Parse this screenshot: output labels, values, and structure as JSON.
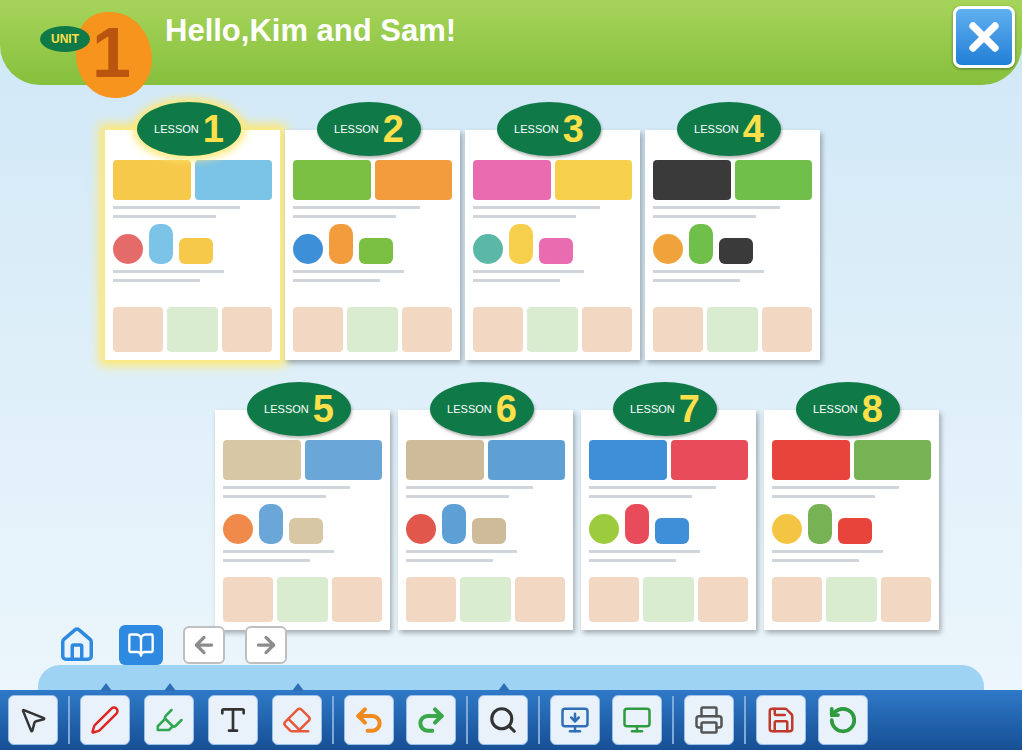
{
  "unit": {
    "label": "UNIT",
    "number": "1"
  },
  "title": "Hello,Kim and Sam!",
  "lessons": [
    {
      "label": "LESSON",
      "number": "1",
      "selected": true
    },
    {
      "label": "LESSON",
      "number": "2",
      "selected": false
    },
    {
      "label": "LESSON",
      "number": "3",
      "selected": false
    },
    {
      "label": "LESSON",
      "number": "4",
      "selected": false
    },
    {
      "label": "LESSON",
      "number": "5",
      "selected": false
    },
    {
      "label": "LESSON",
      "number": "6",
      "selected": false
    },
    {
      "label": "LESSON",
      "number": "7",
      "selected": false
    },
    {
      "label": "LESSON",
      "number": "8",
      "selected": false
    }
  ]
}
